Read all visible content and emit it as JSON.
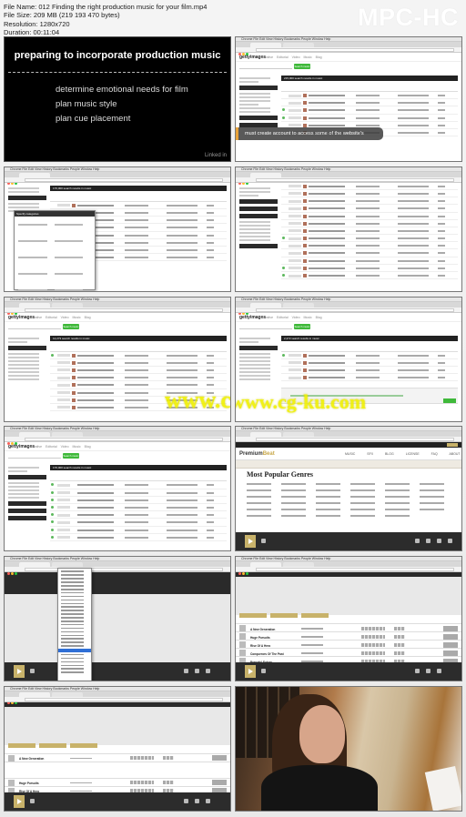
{
  "file_info": {
    "name": "File Name: 012 Finding the right production music for your film.mp4",
    "size": "File Size: 209 MB (219 193 470 bytes)",
    "resolution": "Resolution: 1280x720",
    "duration": "Duration: 00:11:04"
  },
  "brand": "MPC-HC",
  "slide": {
    "title": "preparing to incorporate production music",
    "bullets": [
      "determine emotional needs for film",
      "plan music style",
      "plan cue placement"
    ],
    "logo": "Linked in"
  },
  "caption": "must create account to access some of the website's features",
  "browser": {
    "menu": "Chrome  File  Edit  View  History  Bookmarks  People  Window  Help",
    "getty_logo": "gettyimages",
    "getty_nav": "Creative Editorial Video Music Blog",
    "getty_search_button": "Search music",
    "getty_results": [
      "215,000 search results in music",
      "176,000 search results in music",
      "12,273 search results in music",
      "2,272 search results in music"
    ],
    "specify_categories": "Specify categories",
    "pb_logo_a": "Premium",
    "pb_logo_b": "Beat",
    "pb_nav": "MUSIC SFX BLOG LICENSE FAQ ABOUT CONTACT",
    "pb_genres_title": "Most Popular Genres"
  },
  "pb_tracks": [
    {
      "name": "A New Generation",
      "artist": "Tomarious Orchestra"
    },
    {
      "name": "Huge Pursuits",
      "artist": "Tomarious Orchestra"
    },
    {
      "name": "Rise Of A Hero",
      "artist": "Tomarious Orchestra"
    },
    {
      "name": "Conquerors Of The Past",
      "artist": "Beam Productions"
    },
    {
      "name": "Peaceful Future",
      "artist": "Romantic The Future"
    }
  ],
  "watermark": "www.cg-ku.com"
}
